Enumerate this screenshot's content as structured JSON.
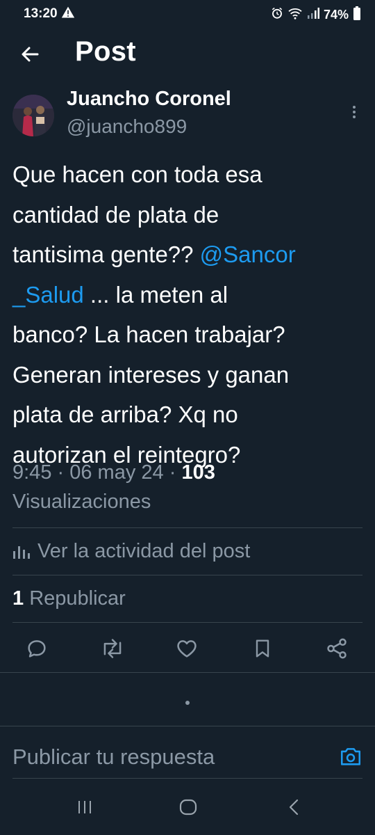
{
  "status_bar": {
    "time": "13:20",
    "battery": "74%"
  },
  "header": {
    "title": "Post"
  },
  "post": {
    "author_name": "Juancho Coronel",
    "author_handle": "@juancho899",
    "text_before_mention": "Que hacen con toda esa\ncantidad de plata de\ntantisima gente?? ",
    "mention": "@Sancor\n_Salud",
    "text_after_mention": " ... la meten al\nbanco? La hacen trabajar?\nGeneran intereses y ganan\nplata de arriba? Xq no\nautorizan el reintegro?",
    "time": "9:45",
    "date": "06 may 24",
    "view_count": "103",
    "view_label": "Visualizaciones",
    "activity_label": "Ver la actividad del post",
    "repost_count": "1",
    "repost_label": "Republicar"
  },
  "reply": {
    "placeholder": "Publicar tu respuesta"
  },
  "colors": {
    "background": "#15202b",
    "accent": "#1d9bf0",
    "secondary_text": "#8b98a5",
    "divider": "#38444d"
  }
}
